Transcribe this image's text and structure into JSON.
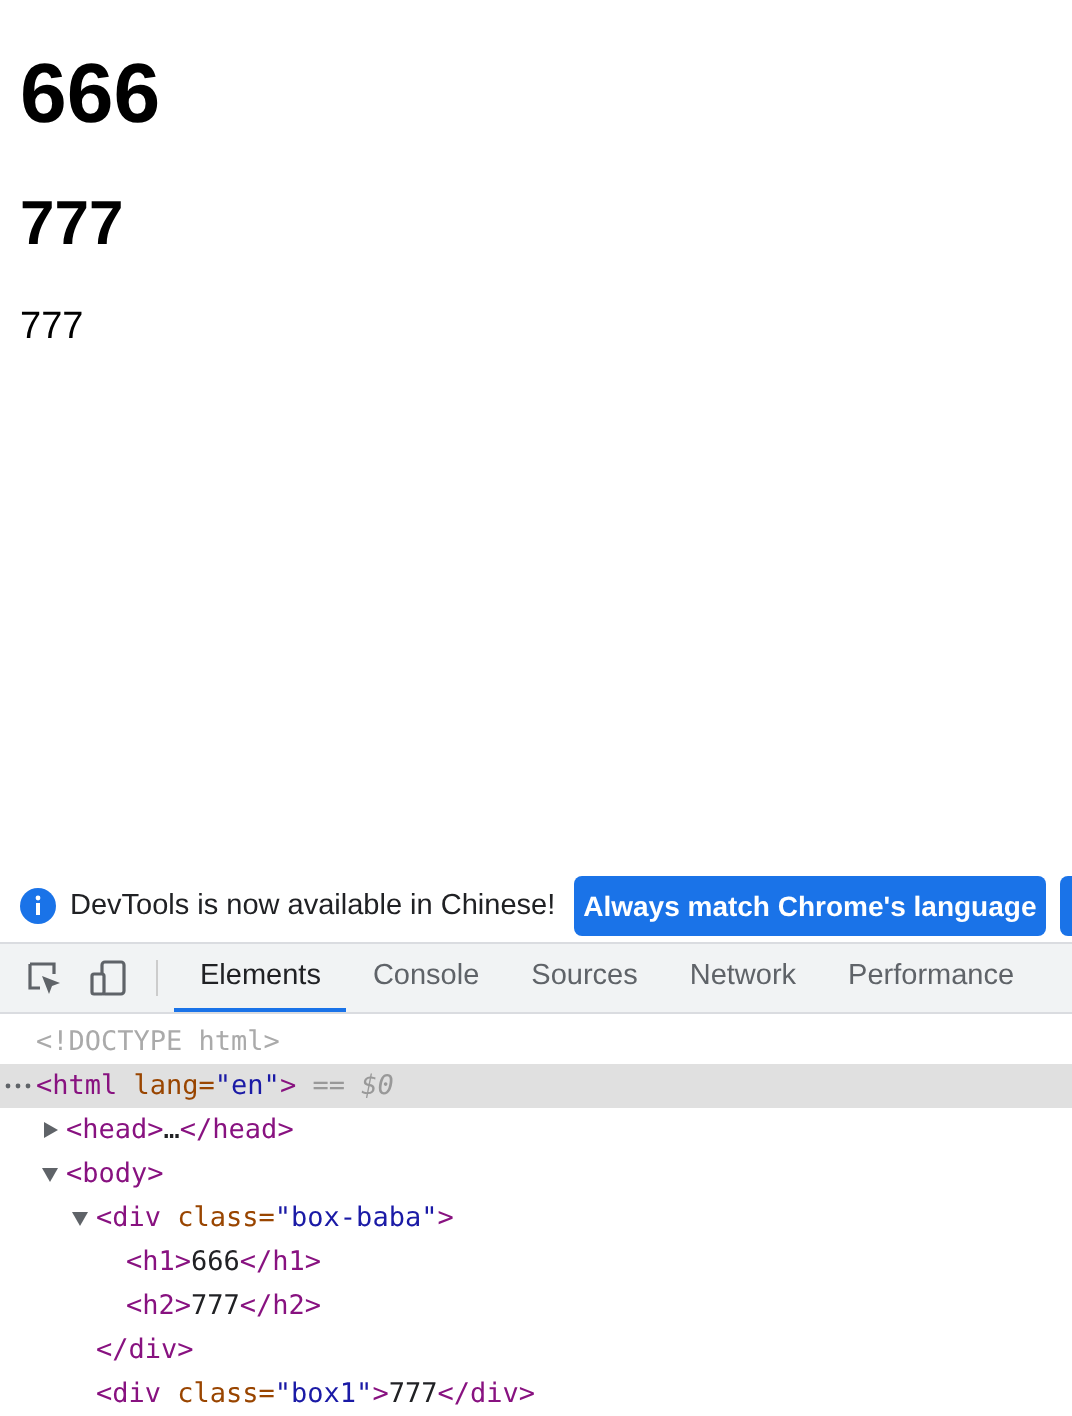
{
  "page": {
    "heading_1": "666",
    "heading_2": "777",
    "text": "777"
  },
  "notification": {
    "message": "DevTools is now available in Chinese!",
    "button": "Always match Chrome's language"
  },
  "tabs": [
    {
      "label": "Elements",
      "selected": true
    },
    {
      "label": "Console",
      "selected": false
    },
    {
      "label": "Sources",
      "selected": false
    },
    {
      "label": "Network",
      "selected": false
    },
    {
      "label": "Performance",
      "selected": false
    }
  ],
  "dom": [
    {
      "selected": false,
      "tokens": [
        {
          "kind": "doctype",
          "text": "<!DOCTYPE html>"
        }
      ]
    },
    {
      "selected": true,
      "tokens": [
        {
          "kind": "tag",
          "text": "<html"
        },
        {
          "kind": "attr",
          "text": " lang="
        },
        {
          "kind": "value",
          "text": "\"en\""
        },
        {
          "kind": "tag",
          "text": ">"
        },
        {
          "kind": "hint",
          "text": " == $0"
        }
      ],
      "children": [
        {
          "selected": false,
          "expanded": false,
          "tokens": [
            {
              "kind": "tag",
              "text": "<head>"
            },
            {
              "kind": "text",
              "text": "…"
            },
            {
              "kind": "tag",
              "text": "</head>"
            }
          ]
        },
        {
          "selected": false,
          "expanded": true,
          "tokens": [
            {
              "kind": "tag",
              "text": "<body>"
            }
          ],
          "children": [
            {
              "selected": false,
              "expanded": true,
              "tokens": [
                {
                  "kind": "tag",
                  "text": "<div"
                },
                {
                  "kind": "attr",
                  "text": " class="
                },
                {
                  "kind": "value",
                  "text": "\"box-baba\""
                },
                {
                  "kind": "tag",
                  "text": ">"
                }
              ],
              "children": [
                {
                  "selected": false,
                  "tokens": [
                    {
                      "kind": "tag",
                      "text": "<h1>"
                    },
                    {
                      "kind": "text",
                      "text": "666"
                    },
                    {
                      "kind": "tag",
                      "text": "</h1>"
                    }
                  ]
                },
                {
                  "selected": false,
                  "tokens": [
                    {
                      "kind": "tag",
                      "text": "<h2>"
                    },
                    {
                      "kind": "text",
                      "text": "777"
                    },
                    {
                      "kind": "tag",
                      "text": "</h2>"
                    }
                  ]
                }
              ],
              "closing": [
                {
                  "kind": "tag",
                  "text": "</div>"
                }
              ]
            },
            {
              "selected": false,
              "tokens": [
                {
                  "kind": "tag",
                  "text": "<div"
                },
                {
                  "kind": "attr",
                  "text": " class="
                },
                {
                  "kind": "value",
                  "text": "\"box1\""
                },
                {
                  "kind": "tag",
                  "text": ">"
                },
                {
                  "kind": "text",
                  "text": "777"
                },
                {
                  "kind": "tag",
                  "text": "</div>"
                }
              ]
            }
          ]
        }
      ]
    }
  ]
}
